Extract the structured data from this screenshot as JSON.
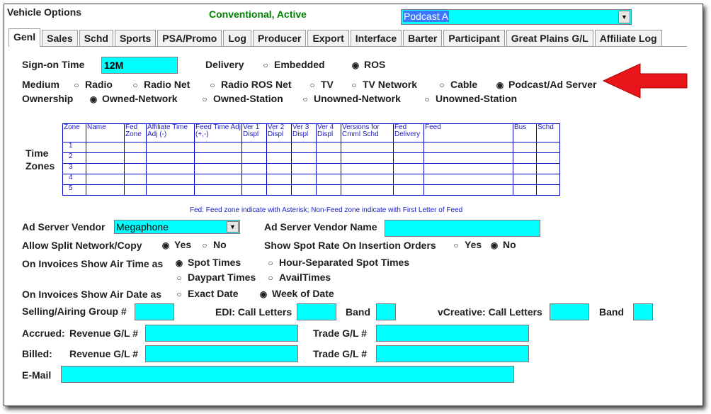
{
  "window": {
    "title": "Vehicle Options",
    "status": "Conventional, Active"
  },
  "vehicle_select": {
    "value": "Podcast A"
  },
  "tabs": [
    "Genl",
    "Sales",
    "Schd",
    "Sports",
    "PSA/Promo",
    "Log",
    "Producer",
    "Export",
    "Interface",
    "Barter",
    "Participant",
    "Great Plains G/L",
    "Affiliate Log"
  ],
  "signon": {
    "label": "Sign-on Time",
    "value": "12M"
  },
  "delivery": {
    "label": "Delivery",
    "options": [
      "Embedded",
      "ROS"
    ],
    "selected": "ROS"
  },
  "medium": {
    "label": "Medium",
    "options": [
      "Radio",
      "Radio Net",
      "Radio ROS Net",
      "TV",
      "TV Network",
      "Cable",
      "Podcast/Ad Server"
    ],
    "selected": "Podcast/Ad Server"
  },
  "ownership": {
    "label": "Ownership",
    "options": [
      "Owned-Network",
      "Owned-Station",
      "Unowned-Network",
      "Unowned-Station"
    ],
    "selected": "Owned-Network"
  },
  "time_zones": {
    "label_line1": "Time",
    "label_line2": "Zones",
    "columns": [
      "Zone",
      "Name",
      "Fed Zone",
      "Affiliate Time Adj (-)",
      "Feed Time Adj (+,-)",
      "Ver 1 Displ",
      "Ver 2 Displ",
      "Ver 3 Displ",
      "Ver 4 Displ",
      "Versions for Cmml Schd",
      "Fed Delivery",
      "Feed",
      "Bus",
      "Schd"
    ],
    "rows": [
      "1",
      "2",
      "3",
      "4",
      "5"
    ],
    "note": "Fed: Feed zone indicate with Asterisk; Non-Feed zone indicate with First Letter of Feed"
  },
  "ad_vendor": {
    "label": "Ad Server Vendor",
    "value": "Megaphone"
  },
  "ad_vendor_name": {
    "label": "Ad Server Vendor Name",
    "value": ""
  },
  "split": {
    "label": "Allow Split Network/Copy",
    "options": [
      "Yes",
      "No"
    ],
    "selected": "Yes"
  },
  "spot_rate": {
    "label": "Show Spot Rate On Insertion Orders",
    "options": [
      "Yes",
      "No"
    ],
    "selected": "No"
  },
  "air_time": {
    "label": "On Invoices Show Air Time as",
    "options": [
      "Spot Times",
      "Hour-Separated Spot Times",
      "Daypart Times",
      "AvailTimes"
    ],
    "selected": "Spot Times"
  },
  "air_date": {
    "label": "On Invoices Show Air Date as",
    "options": [
      "Exact Date",
      "Week of Date"
    ],
    "selected": "Week of Date"
  },
  "selling_group": {
    "label": "Selling/Airing Group #"
  },
  "edi": {
    "label": "EDI: Call Letters",
    "band_label": "Band"
  },
  "vcreative": {
    "label": "vCreative: Call Letters",
    "band_label": "Band"
  },
  "accrued": {
    "label": "Accrued:",
    "revenue_label": "Revenue G/L #",
    "trade_label": "Trade G/L #"
  },
  "billed": {
    "label": "Billed:",
    "revenue_label": "Revenue G/L #",
    "trade_label": "Trade G/L #"
  },
  "email": {
    "label": "E-Mail"
  },
  "colors": {
    "field": "#00ffff",
    "table_border": "#0000c8",
    "arrow": "#e8161b",
    "status": "#008000"
  }
}
